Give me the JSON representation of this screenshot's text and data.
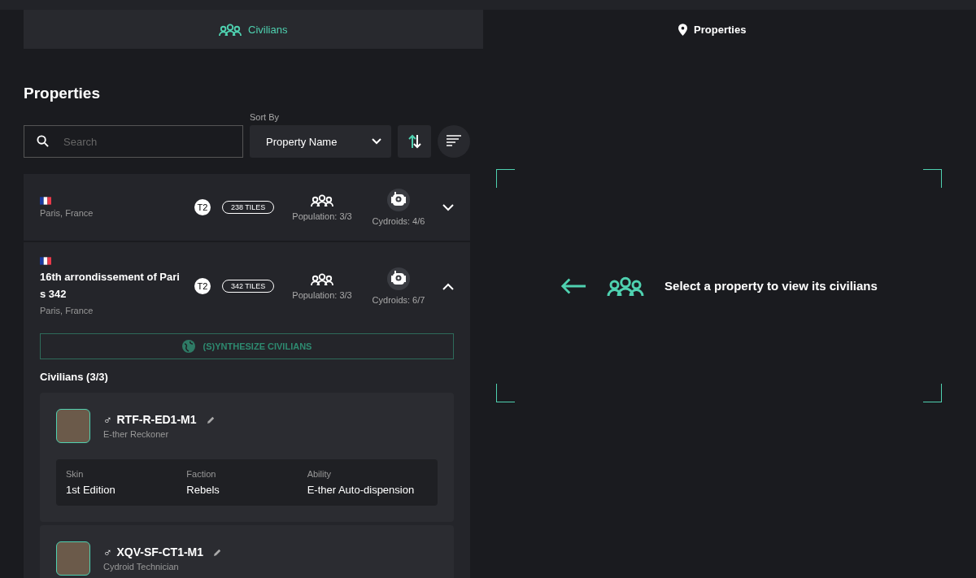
{
  "tabs": [
    {
      "label": "Civilians",
      "selected": false
    },
    {
      "label": "Properties",
      "selected": true
    }
  ],
  "list": {
    "title": "Properties",
    "search": {
      "placeholder": "Search"
    },
    "sort": {
      "label": "Sort By",
      "value": "Property Name"
    }
  },
  "properties": [
    {
      "location": "Paris, France",
      "tier": "T2",
      "tiles": "238 TILES",
      "population": "Population: 3/3",
      "cydroids": "Cydroids: 4/6",
      "expanded": false
    },
    {
      "name": "16th arrondissement of Pari s 342",
      "location": "Paris, France",
      "tier": "T2",
      "tiles": "342 TILES",
      "population": "Population: 3/3",
      "cydroids": "Cydroids: 6/7",
      "expanded": true,
      "synthesize": "(S)YNTHESIZE CIVILIANS",
      "civilians_title": "Civilians (3/3)",
      "civilians": [
        {
          "gender": "♂",
          "id": "RTF-R-ED1-M1",
          "role": "E-ther Reckoner",
          "details": [
            {
              "label": "Skin",
              "value": "1st Edition"
            },
            {
              "label": "Faction",
              "value": "Rebels"
            },
            {
              "label": "Ability",
              "value": "E-ther Auto-dispension"
            }
          ]
        },
        {
          "gender": "♂",
          "id": "XQV-SF-CT1-M1",
          "role": "Cydroid Technician"
        }
      ]
    }
  ],
  "empty": {
    "message": "Select a property to view its civilians"
  }
}
